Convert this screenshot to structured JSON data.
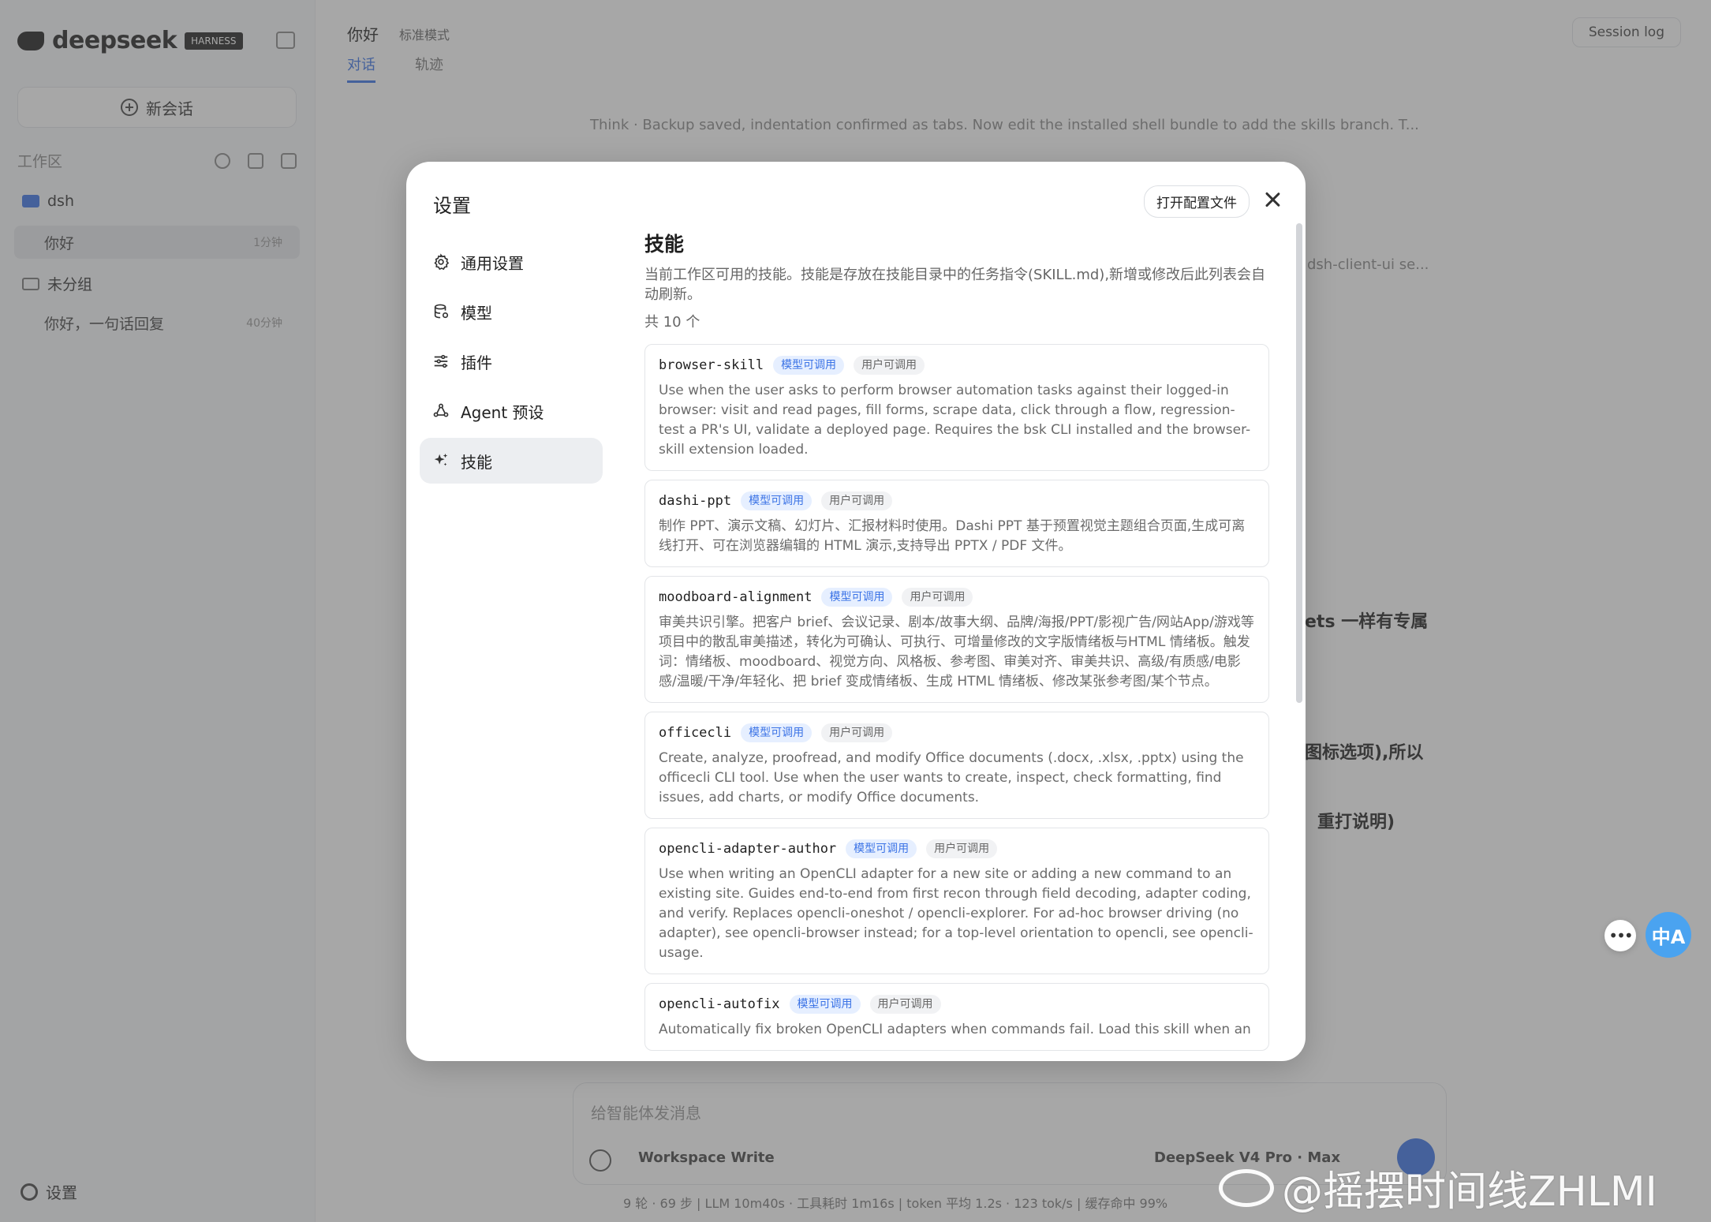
{
  "background": {
    "sidebar": {
      "logo_text": "deepseek",
      "logo_badge": "HARNESS",
      "new_chat_label": "新会话",
      "workspace_label": "工作区",
      "folders": [
        {
          "name": "dsh"
        },
        {
          "name": "未分组"
        }
      ],
      "threads": [
        {
          "title": "你好",
          "time": "1分钟"
        },
        {
          "title": "你好，一句话回复",
          "time": "40分钟"
        }
      ],
      "settings_label": "设置"
    },
    "main": {
      "title": "你好",
      "mode": "标准模式",
      "tabs": [
        "对话",
        "轨迹"
      ],
      "session_log": "Session log",
      "think_line": "Think · Backup saved, indentation confirmed as tabs. Now edit the installed shell bundle to add the skills branch. T...",
      "fragments": [
        "dsh-client-ui se...",
        "ets 一样有专属",
        "图标选项),所以",
        "重打说明)"
      ],
      "composer_placeholder": "给智能体发消息",
      "permission": "Workspace Write",
      "model": "DeepSeek V4 Pro · Max",
      "status": "9 轮 · 69 步  |  LLM 10m40s · 工具耗时 1m16s  |  token 平均 1.2s · 123 tok/s  |  缓存命中 99%"
    }
  },
  "modal": {
    "title": "设置",
    "open_config_label": "打开配置文件",
    "nav": [
      {
        "label": "通用设置",
        "icon": "gear-icon"
      },
      {
        "label": "模型",
        "icon": "database-icon"
      },
      {
        "label": "插件",
        "icon": "sliders-icon"
      },
      {
        "label": "Agent 预设",
        "icon": "agent-icon"
      },
      {
        "label": "技能",
        "icon": "sparkle-icon"
      }
    ],
    "active_nav": "技能",
    "content": {
      "title": "技能",
      "description": "当前工作区可用的技能。技能是存放在技能目录中的任务指令(SKILL.md),新增或修改后此列表会自动刷新。",
      "count": "共 10 个",
      "tag_model": "模型可调用",
      "tag_user": "用户可调用",
      "skills": [
        {
          "name": "browser-skill",
          "description": "Use when the user asks to perform browser automation tasks against their logged-in browser: visit and read pages, fill forms, scrape data, click through a flow, regression-test a PR's UI, validate a deployed page. Requires the bsk CLI installed and the browser-skill extension loaded."
        },
        {
          "name": "dashi-ppt",
          "description": "制作 PPT、演示文稿、幻灯片、汇报材料时使用。Dashi PPT 基于预置视觉主题组合页面,生成可离线打开、可在浏览器编辑的 HTML 演示,支持导出 PPTX / PDF 文件。"
        },
        {
          "name": "moodboard-alignment",
          "description": "审美共识引擎。把客户 brief、会议记录、剧本/故事大纲、品牌/海报/PPT/影视广告/网站App/游戏等项目中的散乱审美描述，转化为可确认、可执行、可增量修改的文字版情绪板与HTML 情绪板。触发词：情绪板、moodboard、视觉方向、风格板、参考图、审美对齐、审美共识、高级/有质感/电影感/温暖/干净/年轻化、把 brief 变成情绪板、生成 HTML 情绪板、修改某张参考图/某个节点。"
        },
        {
          "name": "officecli",
          "description": "Create, analyze, proofread, and modify Office documents (.docx, .xlsx, .pptx) using the officecli CLI tool. Use when the user wants to create, inspect, check formatting, find issues, add charts, or modify Office documents."
        },
        {
          "name": "opencli-adapter-author",
          "description": "Use when writing an OpenCLI adapter for a new site or adding a new command to an existing site. Guides end-to-end from first recon through field decoding, adapter coding, and verify. Replaces opencli-oneshot / opencli-explorer. For ad-hoc browser driving (no adapter), see opencli-browser instead; for a top-level orientation to opencli, see opencli-usage."
        },
        {
          "name": "opencli-autofix",
          "description": "Automatically fix broken OpenCLI adapters when commands fail. Load this skill when an"
        }
      ]
    }
  },
  "floating": {
    "more_label": "•••",
    "translate_label": "中A"
  },
  "watermark": "@摇摆时间线ZHLMI",
  "colors": {
    "accent": "#3b73e6",
    "tag_model_bg": "#e6efff",
    "tag_user_bg": "#f1f2f4",
    "overlay": "rgba(80,80,80,0.5)"
  }
}
